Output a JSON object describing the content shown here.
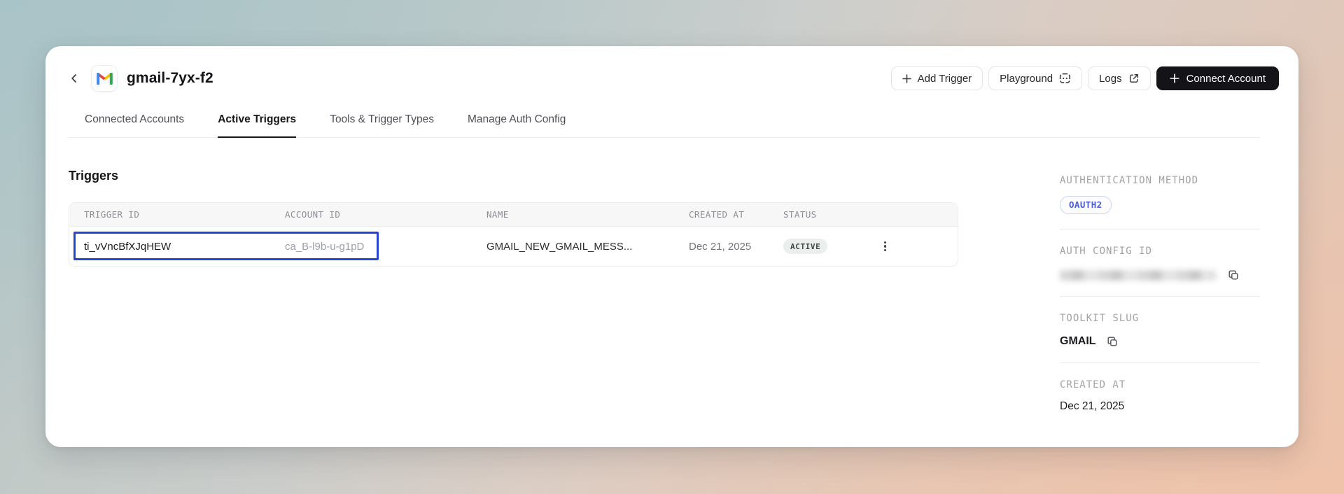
{
  "header": {
    "title": "gmail-7yx-f2",
    "actions": {
      "add_trigger": "Add Trigger",
      "playground": "Playground",
      "logs": "Logs",
      "connect_account": "Connect Account"
    }
  },
  "tabs": [
    {
      "label": "Connected Accounts",
      "active": false
    },
    {
      "label": "Active Triggers",
      "active": true
    },
    {
      "label": "Tools & Trigger Types",
      "active": false
    },
    {
      "label": "Manage Auth Config",
      "active": false
    }
  ],
  "main": {
    "section_title": "Triggers",
    "table": {
      "columns": [
        "TRIGGER ID",
        "ACCOUNT ID",
        "NAME",
        "CREATED AT",
        "STATUS"
      ],
      "rows": [
        {
          "trigger_id": "ti_vVncBfXJqHEW",
          "account_id": "ca_B-l9b-u-g1pD",
          "name": "GMAIL_NEW_GMAIL_MESS...",
          "created_at": "Dec 21, 2025",
          "status": "ACTIVE"
        }
      ]
    }
  },
  "sidebar": {
    "auth_method": {
      "label": "AUTHENTICATION METHOD",
      "value": "OAUTH2"
    },
    "auth_config": {
      "label": "AUTH CONFIG ID",
      "value_redacted": true
    },
    "toolkit_slug": {
      "label": "TOOLKIT SLUG",
      "value": "GMAIL"
    },
    "created_at": {
      "label": "CREATED AT",
      "value": "Dec 21, 2025"
    }
  },
  "colors": {
    "selection_blue": "#2446cf",
    "oauth_badge_text": "#4c5ed8",
    "status_badge_bg": "#ebeeed",
    "status_badge_text": "#3e4b47",
    "bg_gradient_top_left": "#a9c4c8",
    "bg_gradient_bottom_right": "#efc3aa",
    "gmail_blue": "#4285F4",
    "gmail_red": "#EA4335",
    "gmail_yellow": "#FBBC04",
    "gmail_green": "#34A853"
  }
}
